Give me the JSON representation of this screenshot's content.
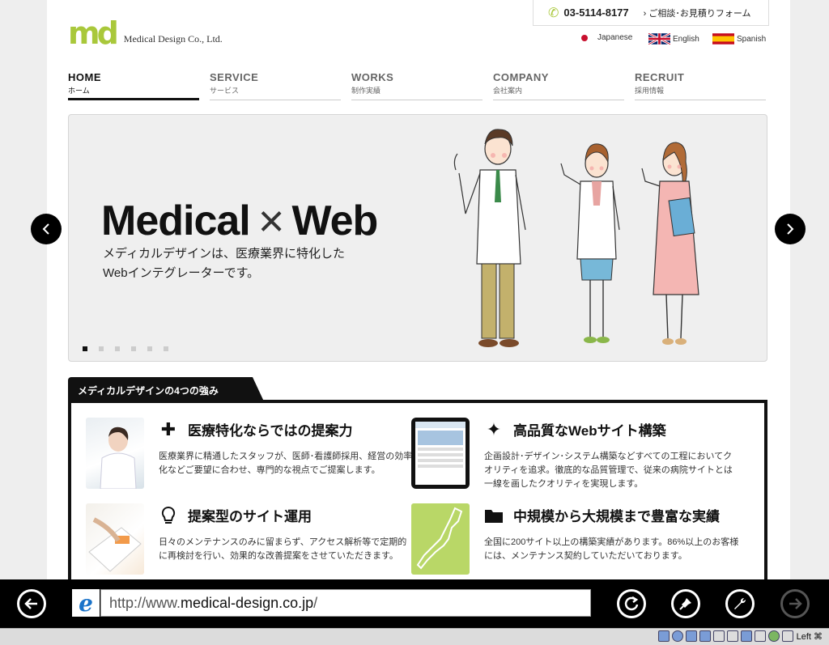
{
  "header": {
    "logo_mark": "md",
    "logo_text": "Medical Design Co., Ltd.",
    "phone": "03-5114-8177",
    "contact_link": "› ご相談･お見積りフォーム",
    "languages": [
      {
        "label": "Japanese",
        "icon": "japan-flag-icon"
      },
      {
        "label": "English",
        "icon": "uk-flag-icon"
      },
      {
        "label": "Spanish",
        "icon": "spain-flag-icon"
      }
    ]
  },
  "nav": [
    {
      "en": "HOME",
      "jp": "ホーム",
      "active": true
    },
    {
      "en": "SERVICE",
      "jp": "サービス"
    },
    {
      "en": "WORKS",
      "jp": "制作実績"
    },
    {
      "en": "COMPANY",
      "jp": "会社案内"
    },
    {
      "en": "RECRUIT",
      "jp": "採用情報"
    }
  ],
  "hero": {
    "title_left": "Medical",
    "title_x": "×",
    "title_right": "Web",
    "subtitle_line1": "メディカルデザインは、医療業界に特化した",
    "subtitle_line2": "Webインテグレーターです。",
    "slide_count": 6,
    "active_slide": 1
  },
  "strengths": {
    "tab_label": "メディカルデザインの4つの強み",
    "cards": [
      {
        "title": "医療特化ならではの提案力",
        "icon": "plus-icon",
        "text": "医療業界に精通したスタッフが、医師･看護師採用、経営の効率化などご要望に合わせ、専門的な視点でご提案します。"
      },
      {
        "title": "高品質なWebサイト構築",
        "icon": "sparkle-icon",
        "text": "企画設計･デザイン･システム構築などすべての工程においてクオリティを追求。徹底的な品質管理で、従来の病院サイトとは一線を画したクオリティを実現します。"
      },
      {
        "title": "提案型のサイト運用",
        "icon": "lightbulb-icon",
        "text": "日々のメンテナンスのみに留まらず、アクセス解析等で定期的に再検討を行い、効果的な改善提案をさせていただきます。"
      },
      {
        "title": "中規模から大規模まで豊富な実績",
        "icon": "folder-icon",
        "text": "全国に200サイト以上の構築実績があります。86%以上のお客様には、メンテナンス契約していただいております。"
      }
    ]
  },
  "browser": {
    "url_prefix": "http://www.",
    "url_domain": "medical-design.co.jp",
    "url_suffix": "/"
  },
  "taskbar": {
    "keyboard_label": "Left ⌘"
  },
  "colors": {
    "brand_green": "#a9c83b",
    "appbar_bg": "#000000"
  }
}
